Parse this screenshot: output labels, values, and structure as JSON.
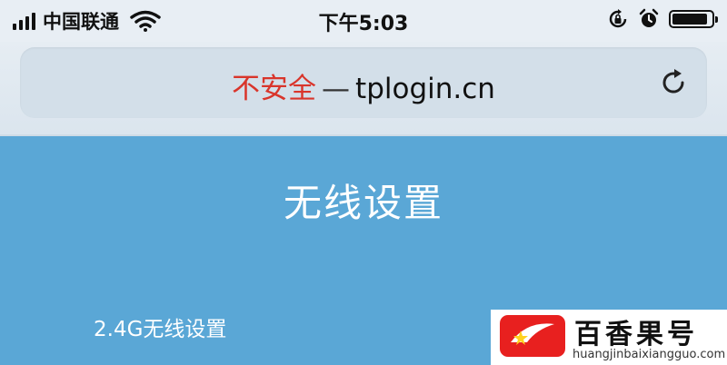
{
  "status_bar": {
    "carrier": "中国联通",
    "time": "下午5:03",
    "battery_level": 0.9,
    "icons": [
      "signal-icon",
      "wifi-icon",
      "rotation-lock-icon",
      "alarm-icon",
      "battery-icon"
    ]
  },
  "browser": {
    "security_label": "不安全",
    "separator": "—",
    "domain": "tplogin.cn",
    "reload_icon": "reload-icon"
  },
  "page": {
    "title": "无线设置",
    "section_label": "2.4G无线设置",
    "background_color": "#5aa7d6"
  },
  "watermark": {
    "name": "百香果号",
    "url": "huangjinbaixiangguo.com",
    "logo_color": "#e8201f"
  }
}
